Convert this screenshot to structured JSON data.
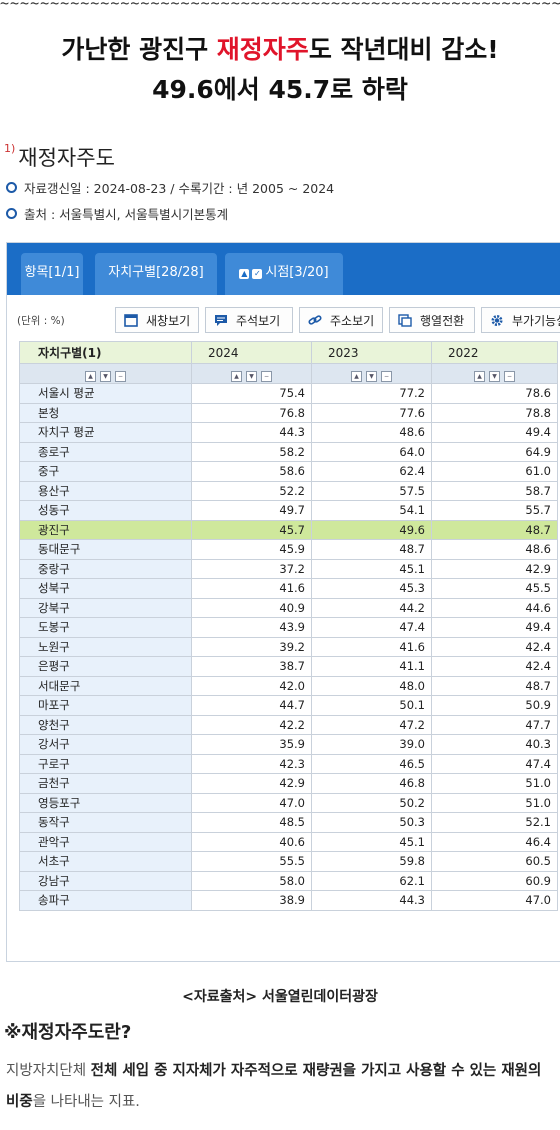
{
  "decor_tilde": "~~~~~~~~~~~~~~~~~~~~~~~~~~~~~~~~~~~~~~~~~~~~~~~~~~~~~~~~~~~~~~",
  "headline": {
    "line1_pre": "가난한 광진구 ",
    "line1_highlight": "재정자주",
    "line1_post": "도 작년대비 감소!",
    "line2": "49.6에서 45.7로 하락"
  },
  "section": {
    "sup": "1)",
    "title": "재정자주도"
  },
  "meta": {
    "updated": "자료갱신일 : 2024-08-23 / 수록기간 : 년 2005 ~ 2024",
    "source": "출처 : 서울특별시, 서울특별시기본통계"
  },
  "tabs": {
    "items": "항목[1/1]",
    "district": "자치구별[28/28]",
    "period": "시점[3/20]"
  },
  "toolbar": {
    "unit": "(단위 : %)",
    "new_window": "새창보기",
    "annotation": "주석보기",
    "address": "주소보기",
    "transpose": "행열전환",
    "extra": "부가기능설정"
  },
  "table": {
    "header_first": "자치구별(1)",
    "years": [
      "2024",
      "2023",
      "2022"
    ],
    "rows": [
      {
        "name": "서울시 평균",
        "v": [
          "75.4",
          "77.2",
          "78.6"
        ]
      },
      {
        "name": "본청",
        "v": [
          "76.8",
          "77.6",
          "78.8"
        ]
      },
      {
        "name": "자치구 평균",
        "v": [
          "44.3",
          "48.6",
          "49.4"
        ]
      },
      {
        "name": "종로구",
        "v": [
          "58.2",
          "64.0",
          "64.9"
        ]
      },
      {
        "name": "중구",
        "v": [
          "58.6",
          "62.4",
          "61.0"
        ]
      },
      {
        "name": "용산구",
        "v": [
          "52.2",
          "57.5",
          "58.7"
        ]
      },
      {
        "name": "성동구",
        "v": [
          "49.7",
          "54.1",
          "55.7"
        ]
      },
      {
        "name": "광진구",
        "v": [
          "45.7",
          "49.6",
          "48.7"
        ],
        "highlight": true
      },
      {
        "name": "동대문구",
        "v": [
          "45.9",
          "48.7",
          "48.6"
        ]
      },
      {
        "name": "중랑구",
        "v": [
          "37.2",
          "45.1",
          "42.9"
        ]
      },
      {
        "name": "성북구",
        "v": [
          "41.6",
          "45.3",
          "45.5"
        ]
      },
      {
        "name": "강북구",
        "v": [
          "40.9",
          "44.2",
          "44.6"
        ]
      },
      {
        "name": "도봉구",
        "v": [
          "43.9",
          "47.4",
          "49.4"
        ]
      },
      {
        "name": "노원구",
        "v": [
          "39.2",
          "41.6",
          "42.4"
        ]
      },
      {
        "name": "은평구",
        "v": [
          "38.7",
          "41.1",
          "42.4"
        ]
      },
      {
        "name": "서대문구",
        "v": [
          "42.0",
          "48.0",
          "48.7"
        ]
      },
      {
        "name": "마포구",
        "v": [
          "44.7",
          "50.1",
          "50.9"
        ]
      },
      {
        "name": "양천구",
        "v": [
          "42.2",
          "47.2",
          "47.7"
        ]
      },
      {
        "name": "강서구",
        "v": [
          "35.9",
          "39.0",
          "40.3"
        ]
      },
      {
        "name": "구로구",
        "v": [
          "42.3",
          "46.5",
          "47.4"
        ]
      },
      {
        "name": "금천구",
        "v": [
          "42.9",
          "46.8",
          "51.0"
        ]
      },
      {
        "name": "영등포구",
        "v": [
          "47.0",
          "50.2",
          "51.0"
        ]
      },
      {
        "name": "동작구",
        "v": [
          "48.5",
          "50.3",
          "52.1"
        ]
      },
      {
        "name": "관악구",
        "v": [
          "40.6",
          "45.1",
          "46.4"
        ]
      },
      {
        "name": "서초구",
        "v": [
          "55.5",
          "59.8",
          "60.5"
        ]
      },
      {
        "name": "강남구",
        "v": [
          "58.0",
          "62.1",
          "60.9"
        ]
      },
      {
        "name": "송파구",
        "v": [
          "38.9",
          "44.3",
          "47.0"
        ]
      }
    ]
  },
  "source_note": "<자료출처> 서울열린데이터광장",
  "definition": {
    "title": "※재정자주도란?",
    "p1": "지방자치단체 ",
    "b1": "전체 세입 중 지자체가 자주적으로 재량권을 가지고 사용할 수 있는 재원의 비중",
    "p2": "을 나타내는 지표."
  },
  "colors": {
    "tab_bar": "#1b6dc6",
    "header_bg": "#e9f4d9",
    "highlight_row": "#cfe89c",
    "headline_red": "#e0142a"
  }
}
